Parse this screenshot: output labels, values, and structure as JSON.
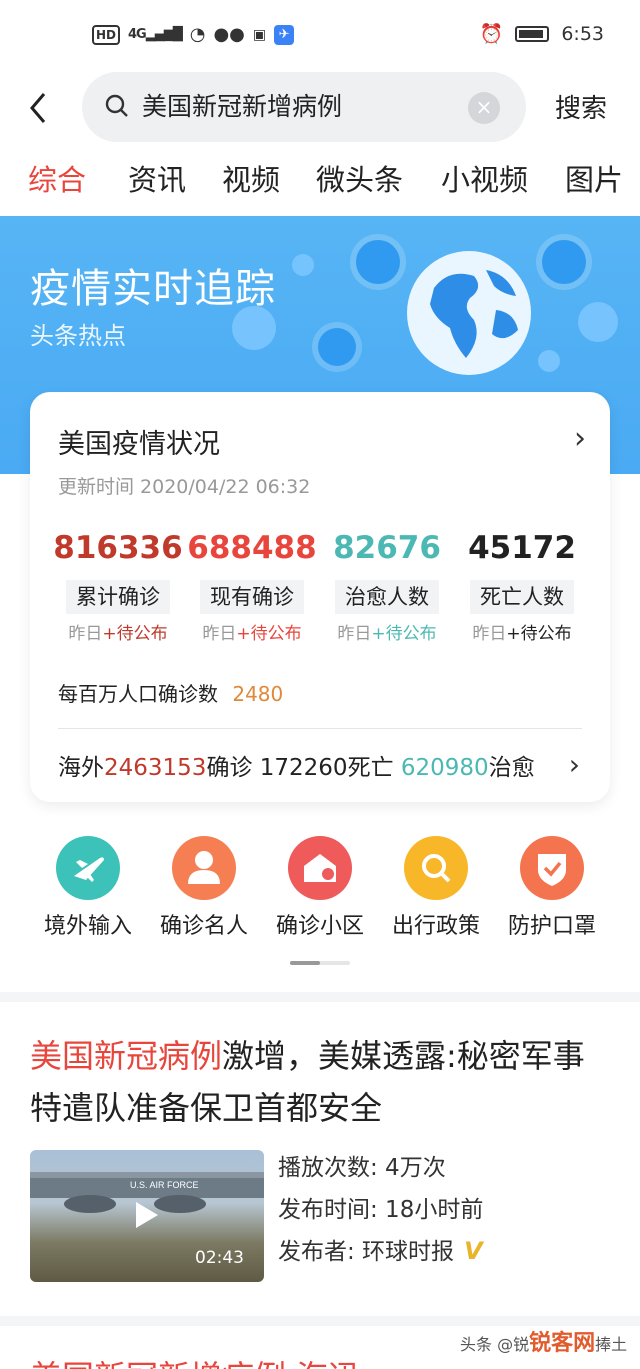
{
  "status_bar": {
    "left_badges": [
      "HD",
      "4G"
    ],
    "time": "6:53"
  },
  "search": {
    "query": "美国新冠新增病例",
    "button": "搜索"
  },
  "tabs": [
    "综合",
    "资讯",
    "视频",
    "微头条",
    "小视频",
    "图片"
  ],
  "banner": {
    "title": "疫情实时追踪",
    "subtitle": "头条热点"
  },
  "card": {
    "title": "美国疫情状况",
    "update_time": "更新时间 2020/04/22 06:32",
    "stats": [
      {
        "value": "816336",
        "label": "累计确诊",
        "note_prefix": "昨日",
        "note_suffix": "+待公布",
        "color": "#c0392b"
      },
      {
        "value": "688488",
        "label": "现有确诊",
        "note_prefix": "昨日",
        "note_suffix": "+待公布",
        "color": "#e8453c"
      },
      {
        "value": "82676",
        "label": "治愈人数",
        "note_prefix": "昨日",
        "note_suffix": "+待公布",
        "color": "#4cb8b3"
      },
      {
        "value": "45172",
        "label": "死亡人数",
        "note_prefix": "昨日",
        "note_suffix": "+待公布",
        "color": "#222222"
      }
    ],
    "per_million_label": "每百万人口确诊数",
    "per_million_value": "2480",
    "overseas": {
      "prefix": "海外",
      "confirmed": "2463153",
      "confirmed_label": "确诊",
      "deaths": "172260",
      "deaths_label": "死亡",
      "recovered": "620980",
      "recovered_label": "治愈"
    }
  },
  "quick_links": [
    {
      "label": "境外输入",
      "icon": "plane-icon",
      "color": "#3cc2b8"
    },
    {
      "label": "确诊名人",
      "icon": "person-icon",
      "color": "#f57f52"
    },
    {
      "label": "确诊小区",
      "icon": "house-pin-icon",
      "color": "#ef5a5a"
    },
    {
      "label": "出行政策",
      "icon": "search-icon",
      "color": "#f7b728"
    },
    {
      "label": "防护口罩",
      "icon": "shield-check-icon",
      "color": "#f4744f"
    }
  ],
  "article": {
    "title_highlight": "美国新冠病例",
    "title_rest": "激增，美媒透露:秘密军事特遣队准备保卫首都安全",
    "duration": "02:43",
    "plane_text": "U.S. AIR FORCE",
    "plays": "播放次数: 4万次",
    "published": "发布时间: 18小时前",
    "publisher": "发布者: 环球时报",
    "publisher_badge": "V"
  },
  "next_article_partial": "美国新冠新增病例 海迅",
  "watermark": {
    "source": "头条 @锐",
    "logo": "锐客网",
    "suffix": "捧土"
  }
}
